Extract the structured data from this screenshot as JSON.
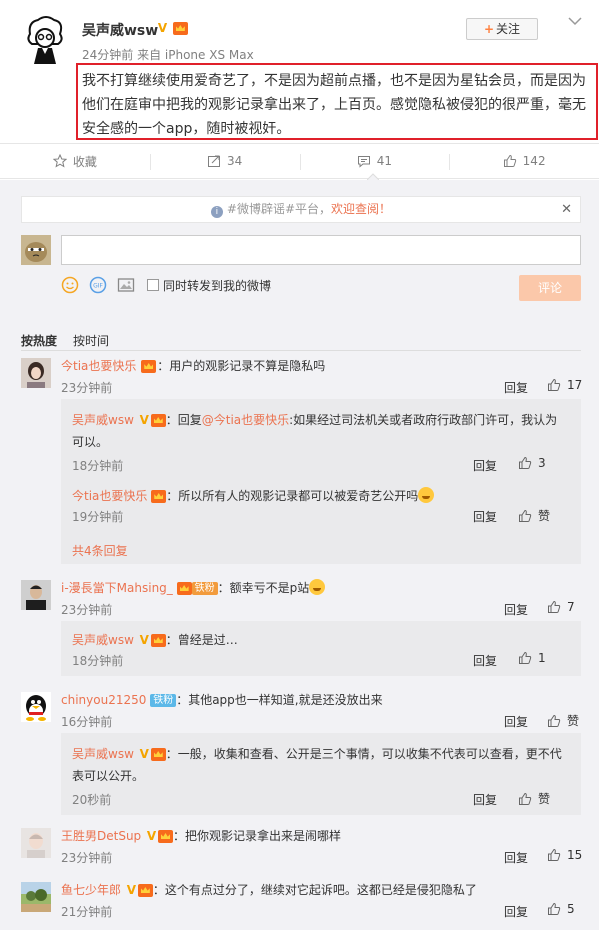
{
  "post": {
    "author": "吴声威wsw",
    "meta": "24分钟前 来自 iPhone XS Max",
    "follow_label": "关注",
    "text": "我不打算继续使用爱奇艺了，不是因为超前点播，也不是因为星钻会员，而是因为他们在庭审中把我的观影记录拿出来了，上百页。感觉隐私被侵犯的很严重，毫无安全感的一个app，随时被视奸。"
  },
  "actions": {
    "favorite": "收藏",
    "repost": "34",
    "comment": "41",
    "like": "142"
  },
  "notice": {
    "prefix": "#微博辟谣#平台，",
    "link": "欢迎查阅！"
  },
  "composer": {
    "repost_label": "同时转发到我的微博",
    "submit_label": "评论"
  },
  "sort": {
    "hot": "按热度",
    "time": "按时间"
  },
  "comments": [
    {
      "name": "今tia也要快乐",
      "text": "：用户的观影记录不算是隐私吗",
      "time": "23分钟前",
      "reply": "回复",
      "likes": "17",
      "replies": [
        {
          "name": "吴声威wsw",
          "prefix": "：回复",
          "mention": "@今tia也要快乐",
          "text": ":如果经过司法机关或者政府行政部门许可，我认为可以。",
          "time": "18分钟前",
          "reply": "回复",
          "likes": "3"
        },
        {
          "name": "今tia也要快乐",
          "text": "：所以所有人的观影记录都可以被爱奇艺公开吗",
          "time": "19分钟前",
          "reply": "回复",
          "likes": "赞"
        }
      ],
      "more": "共4条回复"
    },
    {
      "name": "i-漫長當下Mahsing_",
      "badge": "铁粉",
      "text": "：额幸亏不是p站",
      "time": "23分钟前",
      "reply": "回复",
      "likes": "7",
      "replies": [
        {
          "name": "吴声威wsw",
          "text": "：曾经是过…",
          "time": "18分钟前",
          "reply": "回复",
          "likes": "1"
        }
      ]
    },
    {
      "name": "chinyou21250",
      "badge": "铁粉",
      "text": "：其他app也一样知道,就是还没放出来",
      "time": "16分钟前",
      "reply": "回复",
      "likes": "赞",
      "replies": [
        {
          "name": "吴声威wsw",
          "text": "：一般，收集和查看、公开是三个事情，可以收集不代表可以查看，更不代表可以公开。",
          "time": "20秒前",
          "reply": "回复",
          "likes": "赞"
        }
      ]
    },
    {
      "name": "王胜男DetSup",
      "text": "：把你观影记录拿出来是闹哪样",
      "time": "23分钟前",
      "reply": "回复",
      "likes": "15"
    },
    {
      "name": "鱼七少年郎",
      "text": "：这个有点过分了，继续对它起诉吧。这都已经是侵犯隐私了",
      "time": "21分钟前",
      "reply": "回复",
      "likes": "5"
    }
  ]
}
